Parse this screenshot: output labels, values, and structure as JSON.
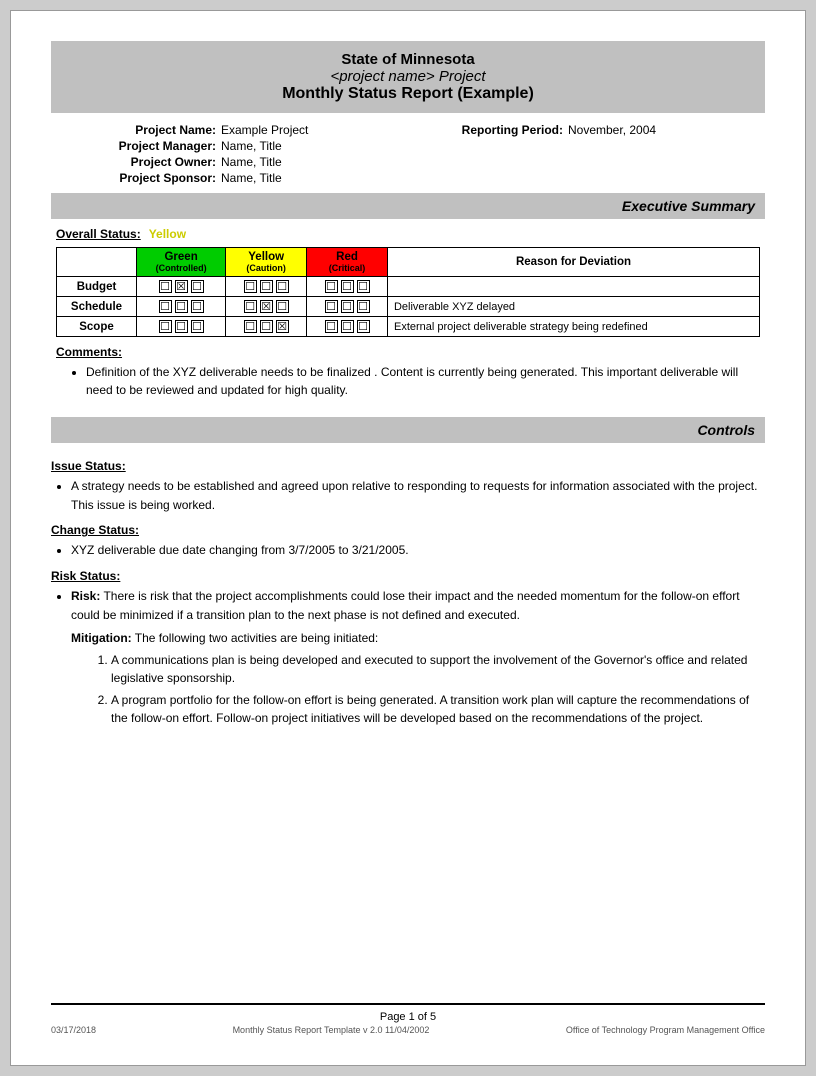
{
  "header": {
    "line1": "State of Minnesota",
    "line2": "<project name> Project",
    "line3": "Monthly Status Report (Example)"
  },
  "project_info": {
    "name_label": "Project Name:",
    "name_value": "Example Project",
    "reporting_label": "Reporting Period:",
    "reporting_value": "November, 2004",
    "manager_label": "Project Manager:",
    "manager_value": "Name, Title",
    "owner_label": "Project Owner:",
    "owner_value": "Name, Title",
    "sponsor_label": "Project Sponsor:",
    "sponsor_value": "Name, Title"
  },
  "executive_summary": {
    "section_title": "Executive Summary",
    "overall_status_label": "Overall Status:",
    "overall_status_value": "Yellow",
    "table": {
      "headers": {
        "empty": "",
        "green": "Green",
        "green_sub": "(Controlled)",
        "yellow": "Yellow",
        "yellow_sub": "(Caution)",
        "red": "Red",
        "red_sub": "(Critical)",
        "reason": "Reason for Deviation"
      },
      "rows": [
        {
          "label": "Budget",
          "green": [
            false,
            true,
            false
          ],
          "yellow": [
            false,
            false,
            false
          ],
          "red": [
            false,
            false,
            false
          ],
          "reason": ""
        },
        {
          "label": "Schedule",
          "green": [
            false,
            false,
            false
          ],
          "yellow": [
            false,
            true,
            false
          ],
          "red": [
            false,
            false,
            false
          ],
          "reason": "Deliverable XYZ delayed"
        },
        {
          "label": "Scope",
          "green": [
            false,
            false,
            false
          ],
          "yellow": [
            false,
            false,
            true
          ],
          "red": [
            false,
            false,
            false
          ],
          "reason": "External project deliverable strategy being redefined"
        }
      ]
    },
    "comments_label": "Comments:",
    "comments": [
      "Definition of the XYZ deliverable  needs to be finalized .  Content is currently being generated.  This important deliverable will need to be reviewed and updated for high quality."
    ]
  },
  "controls": {
    "section_title": "Controls",
    "issue_status_label": "Issue Status:",
    "issue_bullets": [
      "A strategy needs to be established and agreed upon relative to  responding to  requests for information associated with the project.  This issue is being worked."
    ],
    "change_status_label": "Change Status:",
    "change_bullets": [
      "XYZ deliverable due date changing from   3/7/2005 to 3/21/2005."
    ],
    "risk_status_label": "Risk Status:",
    "risk_bullets": [
      "Risk: There is risk that the project accomplishments could lose their impact and the needed momentum for the follow-on effort could be   minimized if a transition plan to the next phase is not defined and executed."
    ],
    "mitigation_label": "Mitigation:",
    "mitigation_intro": "The following two activities are being initiated:",
    "mitigation_items": [
      "A communications plan is being developed and executed to support the involvement of the Governor's office and related legislative sponsorship.",
      "A program portfolio for the follow-on effort is being generated. A transition work plan will capture the recommendations of the follow-on effort. Follow-on project initiatives will be developed based on the recommendations of the project."
    ]
  },
  "footer": {
    "date": "03/17/2018",
    "page": "Page 1 of 5",
    "template_info": "Monthly Status Report Template  v 2.0  11/04/2002",
    "office": "Office of Technology Program Management Office"
  }
}
